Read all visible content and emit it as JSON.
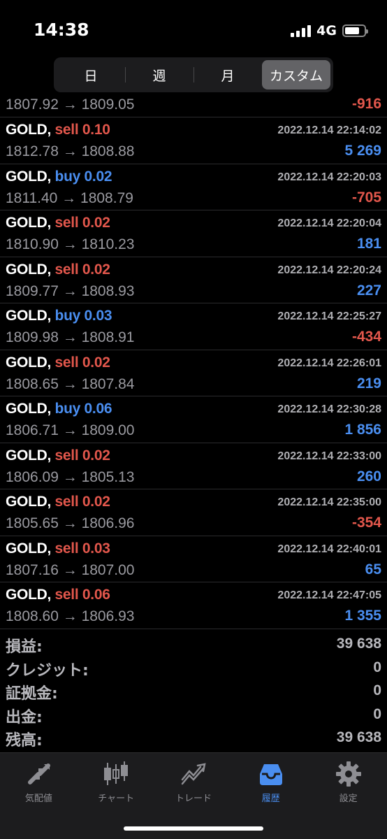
{
  "status_bar": {
    "time": "14:38",
    "network": "4G",
    "battery_level": 0.75
  },
  "period_tabs": [
    {
      "label": "日",
      "active": false
    },
    {
      "label": "週",
      "active": false
    },
    {
      "label": "月",
      "active": false
    },
    {
      "label": "カスタム",
      "active": true
    }
  ],
  "partial_row": {
    "prices": "1807.92 → 1809.05",
    "profit": "-916",
    "profit_sign": "neg"
  },
  "deals": [
    {
      "symbol": "GOLD,",
      "side": "sell",
      "volume": "0.10",
      "time": "2022.12.14 22:14:02",
      "prices": "1812.78 → 1808.88",
      "profit": "5 269",
      "profit_sign": "pos"
    },
    {
      "symbol": "GOLD,",
      "side": "buy",
      "volume": "0.02",
      "time": "2022.12.14 22:20:03",
      "prices": "1811.40 → 1808.79",
      "profit": "-705",
      "profit_sign": "neg"
    },
    {
      "symbol": "GOLD,",
      "side": "sell",
      "volume": "0.02",
      "time": "2022.12.14 22:20:04",
      "prices": "1810.90 → 1810.23",
      "profit": "181",
      "profit_sign": "pos"
    },
    {
      "symbol": "GOLD,",
      "side": "sell",
      "volume": "0.02",
      "time": "2022.12.14 22:20:24",
      "prices": "1809.77 → 1808.93",
      "profit": "227",
      "profit_sign": "pos"
    },
    {
      "symbol": "GOLD,",
      "side": "buy",
      "volume": "0.03",
      "time": "2022.12.14 22:25:27",
      "prices": "1809.98 → 1808.91",
      "profit": "-434",
      "profit_sign": "neg"
    },
    {
      "symbol": "GOLD,",
      "side": "sell",
      "volume": "0.02",
      "time": "2022.12.14 22:26:01",
      "prices": "1808.65 → 1807.84",
      "profit": "219",
      "profit_sign": "pos"
    },
    {
      "symbol": "GOLD,",
      "side": "buy",
      "volume": "0.06",
      "time": "2022.12.14 22:30:28",
      "prices": "1806.71 → 1809.00",
      "profit": "1 856",
      "profit_sign": "pos"
    },
    {
      "symbol": "GOLD,",
      "side": "sell",
      "volume": "0.02",
      "time": "2022.12.14 22:33:00",
      "prices": "1806.09 → 1805.13",
      "profit": "260",
      "profit_sign": "pos"
    },
    {
      "symbol": "GOLD,",
      "side": "sell",
      "volume": "0.02",
      "time": "2022.12.14 22:35:00",
      "prices": "1805.65 → 1806.96",
      "profit": "-354",
      "profit_sign": "neg"
    },
    {
      "symbol": "GOLD,",
      "side": "sell",
      "volume": "0.03",
      "time": "2022.12.14 22:40:01",
      "prices": "1807.16 → 1807.00",
      "profit": "65",
      "profit_sign": "pos"
    },
    {
      "symbol": "GOLD,",
      "side": "sell",
      "volume": "0.06",
      "time": "2022.12.14 22:47:05",
      "prices": "1808.60 → 1806.93",
      "profit": "1 355",
      "profit_sign": "pos"
    }
  ],
  "summary": [
    {
      "label": "損益:",
      "value": "39 638"
    },
    {
      "label": "クレジット:",
      "value": "0"
    },
    {
      "label": "証拠金:",
      "value": "0"
    },
    {
      "label": "出金:",
      "value": "0"
    },
    {
      "label": "残高:",
      "value": "39 638"
    }
  ],
  "tabbar": [
    {
      "label": "気配値",
      "icon": "quotes-arrows-icon",
      "active": false
    },
    {
      "label": "チャート",
      "icon": "candlestick-chart-icon",
      "active": false
    },
    {
      "label": "トレード",
      "icon": "trade-line-icon",
      "active": false
    },
    {
      "label": "履歴",
      "icon": "history-inbox-icon",
      "active": true
    },
    {
      "label": "設定",
      "icon": "gear-icon",
      "active": false
    }
  ],
  "colors": {
    "sell": "#e2574c",
    "buy": "#4a8ef0",
    "positive": "#4a8ef0",
    "negative": "#e2574c",
    "active_tab": "#4a8ef0"
  }
}
